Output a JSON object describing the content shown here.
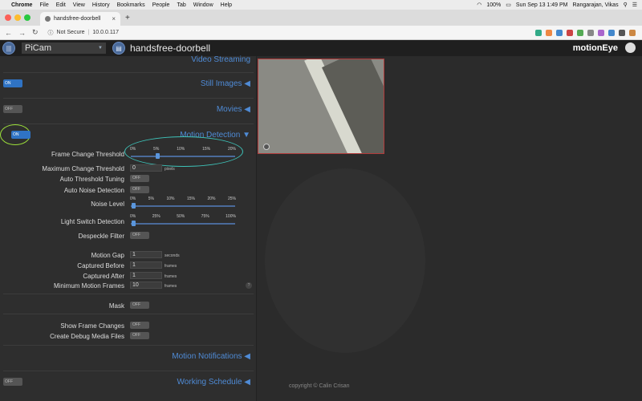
{
  "menubar": {
    "app": "Chrome",
    "items": [
      "File",
      "Edit",
      "View",
      "History",
      "Bookmarks",
      "People",
      "Tab",
      "Window",
      "Help"
    ],
    "battery": "100%",
    "clock": "Sun Sep 13  1:49 PM",
    "user": "Rangarajan, Vikas"
  },
  "browser": {
    "tab_title": "handsfree-doorbell",
    "security": "Not Secure",
    "url": "10.0.0.117"
  },
  "header": {
    "camera_select": "PiCam",
    "camera_name": "handsfree-doorbell",
    "logo": "motionEye"
  },
  "sections": {
    "video_streaming": "Video Streaming",
    "still_images": "Still Images",
    "movies": "Movies",
    "motion_detection": "Motion Detection",
    "motion_notifications": "Motion Notifications",
    "working_schedule": "Working Schedule"
  },
  "toggles": {
    "still_images": "ON",
    "movies": "OFF",
    "motion_detection": "ON",
    "working_schedule": "OFF"
  },
  "settings": {
    "frame_change_threshold": {
      "label": "Frame Change Threshold",
      "ticks": [
        "0%",
        "5%",
        "10%",
        "15%",
        "20%"
      ],
      "value_percent": 3
    },
    "max_change_threshold": {
      "label": "Maximum Change Threshold",
      "value": "0",
      "unit": "pixels"
    },
    "auto_threshold_tuning": {
      "label": "Auto Threshold Tuning",
      "state": "OFF"
    },
    "auto_noise_detection": {
      "label": "Auto Noise Detection",
      "state": "OFF"
    },
    "noise_level": {
      "label": "Noise Level",
      "ticks": [
        "0%",
        "5%",
        "10%",
        "15%",
        "20%",
        "25%"
      ],
      "value_percent": 0
    },
    "light_switch_detection": {
      "label": "Light Switch Detection",
      "ticks": [
        "0%",
        "25%",
        "50%",
        "75%",
        "100%"
      ],
      "value_percent": 0
    },
    "despeckle_filter": {
      "label": "Despeckle Filter",
      "state": "OFF"
    },
    "motion_gap": {
      "label": "Motion Gap",
      "value": "1",
      "unit": "seconds"
    },
    "captured_before": {
      "label": "Captured Before",
      "value": "1",
      "unit": "frames"
    },
    "captured_after": {
      "label": "Captured After",
      "value": "1",
      "unit": "frames"
    },
    "min_motion_frames": {
      "label": "Minimum Motion Frames",
      "value": "10",
      "unit": "frames"
    },
    "mask": {
      "label": "Mask",
      "state": "OFF"
    },
    "show_frame_changes": {
      "label": "Show Frame Changes",
      "state": "OFF"
    },
    "create_debug_media": {
      "label": "Create Debug Media Files",
      "state": "OFF"
    }
  },
  "footer": "copyright © Calin Crisan",
  "colors": {
    "accent": "#4f8bd6",
    "toggle_on": "#2f73c4",
    "highlight_ellipse": "#3ec3b9",
    "highlight_ring": "#9de13a"
  }
}
